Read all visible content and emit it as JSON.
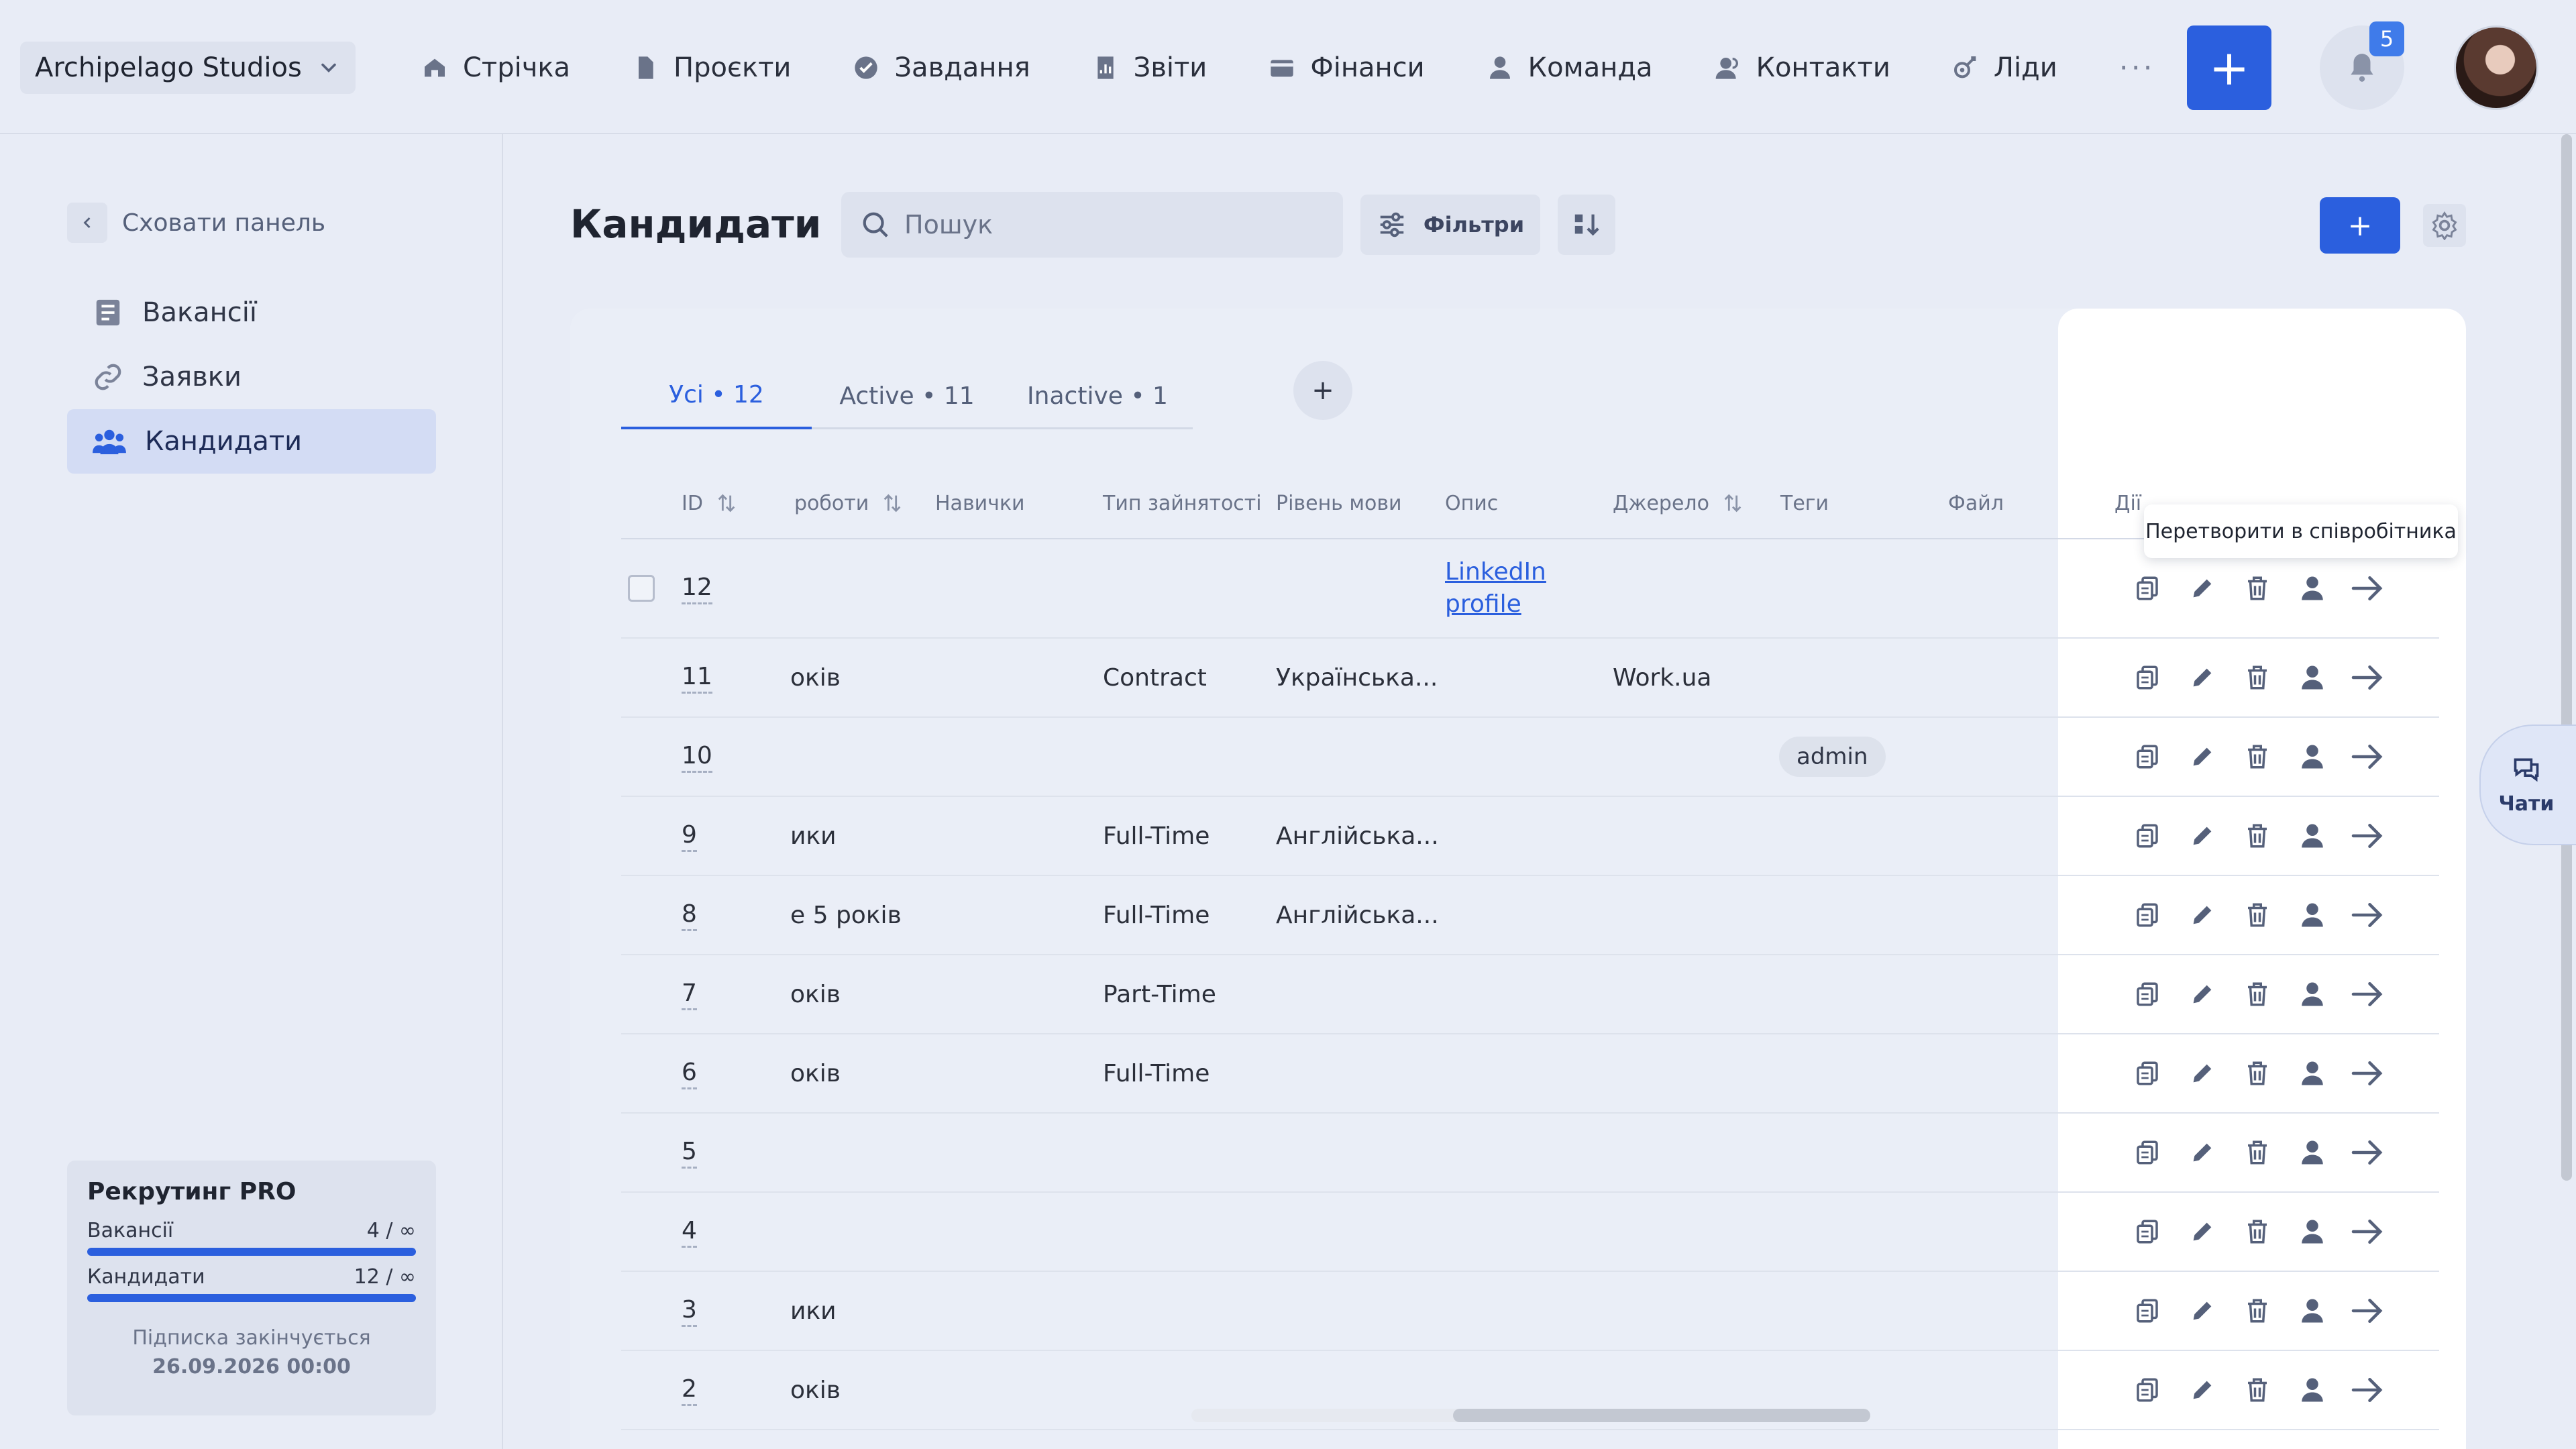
{
  "workspace": {
    "name": "Archipelago Studios"
  },
  "nav": {
    "items": [
      {
        "label": "Стрічка",
        "icon": "home-icon"
      },
      {
        "label": "Проєкти",
        "icon": "document-icon"
      },
      {
        "label": "Завдання",
        "icon": "check-circle-icon"
      },
      {
        "label": "Звіти",
        "icon": "chart-icon"
      },
      {
        "label": "Фінанси",
        "icon": "wallet-icon"
      },
      {
        "label": "Команда",
        "icon": "user-icon"
      },
      {
        "label": "Контакти",
        "icon": "contacts-icon"
      },
      {
        "label": "Ліди",
        "icon": "leads-icon"
      }
    ],
    "more": "···",
    "add": "+",
    "notifications_count": "5"
  },
  "sidebar": {
    "hide_label": "Сховати панель",
    "items": [
      {
        "label": "Вакансії",
        "icon": "list-icon",
        "active": false
      },
      {
        "label": "Заявки",
        "icon": "link-icon",
        "active": false
      },
      {
        "label": "Кандидати",
        "icon": "people-icon",
        "active": true
      }
    ],
    "plan": {
      "title": "Рекрутинг PRO",
      "rows": [
        {
          "label": "Вакансії",
          "value": "4 / ∞"
        },
        {
          "label": "Кандидати",
          "value": "12 / ∞"
        }
      ],
      "expires_label": "Підписка закінчується",
      "expires_date": "26.09.2026 00:00"
    }
  },
  "main": {
    "title": "Кандидати",
    "search_placeholder": "Пошук",
    "filters_label": "Фільтри",
    "create_label": "+",
    "tabs": [
      {
        "label": "Усі • 12",
        "active": true
      },
      {
        "label": "Active • 11",
        "active": false
      },
      {
        "label": "Inactive • 1",
        "active": false
      }
    ],
    "tab_add": "+",
    "columns": [
      "ID",
      "роботи",
      "Навички",
      "Тип зайнятості",
      "Рівень мови",
      "Опис",
      "Джерело",
      "Теги",
      "Файл",
      "Дії"
    ],
    "rows": [
      {
        "id": "12",
        "work": "",
        "type": "",
        "lang": "",
        "desc": "LinkedIn profile",
        "source": "",
        "tag": ""
      },
      {
        "id": "11",
        "work": "оків",
        "type": "Contract",
        "lang": "Українська...",
        "desc": "",
        "source": "Work.ua",
        "tag": ""
      },
      {
        "id": "10",
        "work": "",
        "type": "",
        "lang": "",
        "desc": "",
        "source": "",
        "tag": "admin"
      },
      {
        "id": "9",
        "work": "ики",
        "type": "Full-Time",
        "lang": "Англійська...",
        "desc": "",
        "source": "",
        "tag": ""
      },
      {
        "id": "8",
        "work": "е 5 років",
        "type": "Full-Time",
        "lang": "Англійська...",
        "desc": "",
        "source": "",
        "tag": ""
      },
      {
        "id": "7",
        "work": "оків",
        "type": "Part-Time",
        "lang": "",
        "desc": "",
        "source": "",
        "tag": ""
      },
      {
        "id": "6",
        "work": "оків",
        "type": "Full-Time",
        "lang": "",
        "desc": "",
        "source": "",
        "tag": ""
      },
      {
        "id": "5",
        "work": "",
        "type": "",
        "lang": "",
        "desc": "",
        "source": "",
        "tag": ""
      },
      {
        "id": "4",
        "work": "",
        "type": "",
        "lang": "",
        "desc": "",
        "source": "",
        "tag": ""
      },
      {
        "id": "3",
        "work": "ики",
        "type": "",
        "lang": "",
        "desc": "",
        "source": "",
        "tag": ""
      },
      {
        "id": "2",
        "work": "оків",
        "type": "",
        "lang": "",
        "desc": "",
        "source": "",
        "tag": ""
      }
    ],
    "tooltip": "Перетворити в співробітника"
  },
  "chats": {
    "label": "Чати"
  },
  "colors": {
    "accent": "#2b5fde",
    "background": "#e8ecf6"
  }
}
